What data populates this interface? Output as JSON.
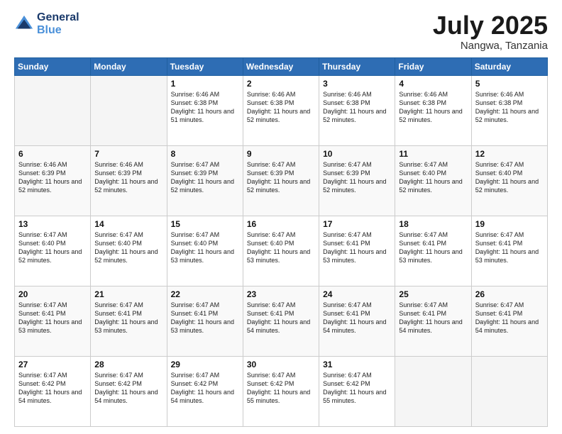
{
  "header": {
    "logo_line1": "General",
    "logo_line2": "Blue",
    "month": "July 2025",
    "location": "Nangwa, Tanzania"
  },
  "days_of_week": [
    "Sunday",
    "Monday",
    "Tuesday",
    "Wednesday",
    "Thursday",
    "Friday",
    "Saturday"
  ],
  "weeks": [
    [
      {
        "day": "",
        "sunrise": "",
        "sunset": "",
        "daylight": ""
      },
      {
        "day": "",
        "sunrise": "",
        "sunset": "",
        "daylight": ""
      },
      {
        "day": "1",
        "sunrise": "Sunrise: 6:46 AM",
        "sunset": "Sunset: 6:38 PM",
        "daylight": "Daylight: 11 hours and 51 minutes."
      },
      {
        "day": "2",
        "sunrise": "Sunrise: 6:46 AM",
        "sunset": "Sunset: 6:38 PM",
        "daylight": "Daylight: 11 hours and 52 minutes."
      },
      {
        "day": "3",
        "sunrise": "Sunrise: 6:46 AM",
        "sunset": "Sunset: 6:38 PM",
        "daylight": "Daylight: 11 hours and 52 minutes."
      },
      {
        "day": "4",
        "sunrise": "Sunrise: 6:46 AM",
        "sunset": "Sunset: 6:38 PM",
        "daylight": "Daylight: 11 hours and 52 minutes."
      },
      {
        "day": "5",
        "sunrise": "Sunrise: 6:46 AM",
        "sunset": "Sunset: 6:38 PM",
        "daylight": "Daylight: 11 hours and 52 minutes."
      }
    ],
    [
      {
        "day": "6",
        "sunrise": "Sunrise: 6:46 AM",
        "sunset": "Sunset: 6:39 PM",
        "daylight": "Daylight: 11 hours and 52 minutes."
      },
      {
        "day": "7",
        "sunrise": "Sunrise: 6:46 AM",
        "sunset": "Sunset: 6:39 PM",
        "daylight": "Daylight: 11 hours and 52 minutes."
      },
      {
        "day": "8",
        "sunrise": "Sunrise: 6:47 AM",
        "sunset": "Sunset: 6:39 PM",
        "daylight": "Daylight: 11 hours and 52 minutes."
      },
      {
        "day": "9",
        "sunrise": "Sunrise: 6:47 AM",
        "sunset": "Sunset: 6:39 PM",
        "daylight": "Daylight: 11 hours and 52 minutes."
      },
      {
        "day": "10",
        "sunrise": "Sunrise: 6:47 AM",
        "sunset": "Sunset: 6:39 PM",
        "daylight": "Daylight: 11 hours and 52 minutes."
      },
      {
        "day": "11",
        "sunrise": "Sunrise: 6:47 AM",
        "sunset": "Sunset: 6:40 PM",
        "daylight": "Daylight: 11 hours and 52 minutes."
      },
      {
        "day": "12",
        "sunrise": "Sunrise: 6:47 AM",
        "sunset": "Sunset: 6:40 PM",
        "daylight": "Daylight: 11 hours and 52 minutes."
      }
    ],
    [
      {
        "day": "13",
        "sunrise": "Sunrise: 6:47 AM",
        "sunset": "Sunset: 6:40 PM",
        "daylight": "Daylight: 11 hours and 52 minutes."
      },
      {
        "day": "14",
        "sunrise": "Sunrise: 6:47 AM",
        "sunset": "Sunset: 6:40 PM",
        "daylight": "Daylight: 11 hours and 52 minutes."
      },
      {
        "day": "15",
        "sunrise": "Sunrise: 6:47 AM",
        "sunset": "Sunset: 6:40 PM",
        "daylight": "Daylight: 11 hours and 53 minutes."
      },
      {
        "day": "16",
        "sunrise": "Sunrise: 6:47 AM",
        "sunset": "Sunset: 6:40 PM",
        "daylight": "Daylight: 11 hours and 53 minutes."
      },
      {
        "day": "17",
        "sunrise": "Sunrise: 6:47 AM",
        "sunset": "Sunset: 6:41 PM",
        "daylight": "Daylight: 11 hours and 53 minutes."
      },
      {
        "day": "18",
        "sunrise": "Sunrise: 6:47 AM",
        "sunset": "Sunset: 6:41 PM",
        "daylight": "Daylight: 11 hours and 53 minutes."
      },
      {
        "day": "19",
        "sunrise": "Sunrise: 6:47 AM",
        "sunset": "Sunset: 6:41 PM",
        "daylight": "Daylight: 11 hours and 53 minutes."
      }
    ],
    [
      {
        "day": "20",
        "sunrise": "Sunrise: 6:47 AM",
        "sunset": "Sunset: 6:41 PM",
        "daylight": "Daylight: 11 hours and 53 minutes."
      },
      {
        "day": "21",
        "sunrise": "Sunrise: 6:47 AM",
        "sunset": "Sunset: 6:41 PM",
        "daylight": "Daylight: 11 hours and 53 minutes."
      },
      {
        "day": "22",
        "sunrise": "Sunrise: 6:47 AM",
        "sunset": "Sunset: 6:41 PM",
        "daylight": "Daylight: 11 hours and 53 minutes."
      },
      {
        "day": "23",
        "sunrise": "Sunrise: 6:47 AM",
        "sunset": "Sunset: 6:41 PM",
        "daylight": "Daylight: 11 hours and 54 minutes."
      },
      {
        "day": "24",
        "sunrise": "Sunrise: 6:47 AM",
        "sunset": "Sunset: 6:41 PM",
        "daylight": "Daylight: 11 hours and 54 minutes."
      },
      {
        "day": "25",
        "sunrise": "Sunrise: 6:47 AM",
        "sunset": "Sunset: 6:41 PM",
        "daylight": "Daylight: 11 hours and 54 minutes."
      },
      {
        "day": "26",
        "sunrise": "Sunrise: 6:47 AM",
        "sunset": "Sunset: 6:41 PM",
        "daylight": "Daylight: 11 hours and 54 minutes."
      }
    ],
    [
      {
        "day": "27",
        "sunrise": "Sunrise: 6:47 AM",
        "sunset": "Sunset: 6:42 PM",
        "daylight": "Daylight: 11 hours and 54 minutes."
      },
      {
        "day": "28",
        "sunrise": "Sunrise: 6:47 AM",
        "sunset": "Sunset: 6:42 PM",
        "daylight": "Daylight: 11 hours and 54 minutes."
      },
      {
        "day": "29",
        "sunrise": "Sunrise: 6:47 AM",
        "sunset": "Sunset: 6:42 PM",
        "daylight": "Daylight: 11 hours and 54 minutes."
      },
      {
        "day": "30",
        "sunrise": "Sunrise: 6:47 AM",
        "sunset": "Sunset: 6:42 PM",
        "daylight": "Daylight: 11 hours and 55 minutes."
      },
      {
        "day": "31",
        "sunrise": "Sunrise: 6:47 AM",
        "sunset": "Sunset: 6:42 PM",
        "daylight": "Daylight: 11 hours and 55 minutes."
      },
      {
        "day": "",
        "sunrise": "",
        "sunset": "",
        "daylight": ""
      },
      {
        "day": "",
        "sunrise": "",
        "sunset": "",
        "daylight": ""
      }
    ]
  ]
}
